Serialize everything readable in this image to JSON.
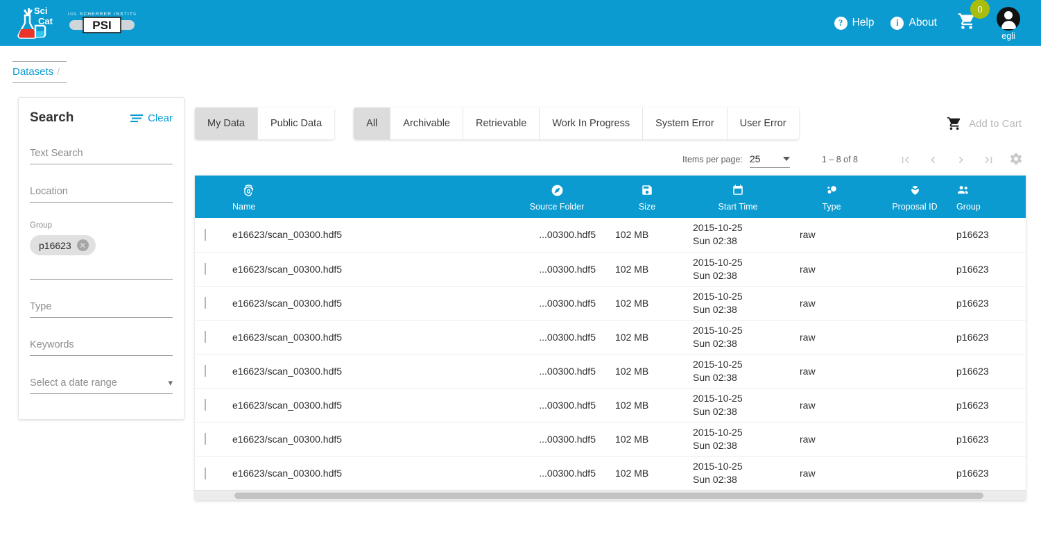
{
  "app": {
    "logo_primary": "scicat-logo",
    "logo_secondary": "psi-logo",
    "psi_tagline": "PAUL SCHERRER INSTITUT",
    "psi_name": "PSI",
    "scicat_name_top": "Sci",
    "scicat_name_bottom": "Cat",
    "brand_color": "#0b9bd0",
    "badge_color": "#a9bd0d"
  },
  "header": {
    "help_label": "Help",
    "help_glyph": "?",
    "about_label": "About",
    "about_glyph": "i",
    "cart_icon": "shopping-cart-icon",
    "cart_count": "0",
    "avatar_icon": "avatar-icon",
    "username": "egli"
  },
  "breadcrumb": {
    "items": [
      {
        "label": "Datasets"
      }
    ],
    "separator": "/"
  },
  "sidebar": {
    "title": "Search",
    "clear_label": "Clear",
    "clear_icon": "filter-icon",
    "text_search": {
      "label": "Text Search",
      "placeholder": "Text Search",
      "value": ""
    },
    "location": {
      "label": "Location",
      "placeholder": "Location",
      "value": ""
    },
    "group": {
      "label": "Group",
      "chips": [
        {
          "label": "p16623",
          "remove_icon": "close-icon"
        }
      ]
    },
    "type": {
      "label": "Type",
      "placeholder": "Type",
      "value": ""
    },
    "keywords": {
      "label": "Keywords",
      "placeholder": "Keywords",
      "value": ""
    },
    "date_range": {
      "label": "Select a date range",
      "value": "Select a date range",
      "chevron": "chevron-down-icon"
    }
  },
  "toolbar": {
    "ownership_tabs": [
      {
        "label": "My Data",
        "active": true
      },
      {
        "label": "Public Data",
        "active": false
      }
    ],
    "status_tabs": [
      {
        "label": "All",
        "active": true
      },
      {
        "label": "Archivable",
        "active": false
      },
      {
        "label": "Retrievable",
        "active": false
      },
      {
        "label": "Work In Progress",
        "active": false
      },
      {
        "label": "System Error",
        "active": false
      },
      {
        "label": "User Error",
        "active": false
      }
    ],
    "add_to_cart_label": "Add to Cart",
    "add_to_cart_icon": "shopping-cart-icon"
  },
  "pagination": {
    "items_per_page_label": "Items per page:",
    "items_per_page_value": "25",
    "range_label": "1 – 8 of 8",
    "first_page_icon": "first-page-icon",
    "prev_page_icon": "previous-page-icon",
    "next_page_icon": "next-page-icon",
    "last_page_icon": "last-page-icon",
    "settings_icon": "gear-icon"
  },
  "table": {
    "columns": [
      {
        "key": "name",
        "label": "Name",
        "icon": "fingerprint-icon"
      },
      {
        "key": "sourceFolder",
        "label": "Source Folder",
        "icon": "explore-compass-icon"
      },
      {
        "key": "size",
        "label": "Size",
        "icon": "save-floppy-icon"
      },
      {
        "key": "startTime",
        "label": "Start Time",
        "icon": "calendar-icon"
      },
      {
        "key": "type",
        "label": "Type",
        "icon": "bubble-chart-icon"
      },
      {
        "key": "proposalId",
        "label": "Proposal ID",
        "icon": "eco-leaf-icon"
      },
      {
        "key": "group",
        "label": "Group",
        "icon": "people-icon"
      }
    ],
    "rows": [
      {
        "name": "e16623/scan_00300.hdf5",
        "sourceFolder": "...00300.hdf5",
        "size": "102 MB",
        "date": "2015-10-25",
        "time": "Sun 02:38",
        "type": "raw",
        "proposalId": "",
        "group": "p16623"
      },
      {
        "name": "e16623/scan_00300.hdf5",
        "sourceFolder": "...00300.hdf5",
        "size": "102 MB",
        "date": "2015-10-25",
        "time": "Sun 02:38",
        "type": "raw",
        "proposalId": "",
        "group": "p16623"
      },
      {
        "name": "e16623/scan_00300.hdf5",
        "sourceFolder": "...00300.hdf5",
        "size": "102 MB",
        "date": "2015-10-25",
        "time": "Sun 02:38",
        "type": "raw",
        "proposalId": "",
        "group": "p16623"
      },
      {
        "name": "e16623/scan_00300.hdf5",
        "sourceFolder": "...00300.hdf5",
        "size": "102 MB",
        "date": "2015-10-25",
        "time": "Sun 02:38",
        "type": "raw",
        "proposalId": "",
        "group": "p16623"
      },
      {
        "name": "e16623/scan_00300.hdf5",
        "sourceFolder": "...00300.hdf5",
        "size": "102 MB",
        "date": "2015-10-25",
        "time": "Sun 02:38",
        "type": "raw",
        "proposalId": "",
        "group": "p16623"
      },
      {
        "name": "e16623/scan_00300.hdf5",
        "sourceFolder": "...00300.hdf5",
        "size": "102 MB",
        "date": "2015-10-25",
        "time": "Sun 02:38",
        "type": "raw",
        "proposalId": "",
        "group": "p16623"
      },
      {
        "name": "e16623/scan_00300.hdf5",
        "sourceFolder": "...00300.hdf5",
        "size": "102 MB",
        "date": "2015-10-25",
        "time": "Sun 02:38",
        "type": "raw",
        "proposalId": "",
        "group": "p16623"
      },
      {
        "name": "e16623/scan_00300.hdf5",
        "sourceFolder": "...00300.hdf5",
        "size": "102 MB",
        "date": "2015-10-25",
        "time": "Sun 02:38",
        "type": "raw",
        "proposalId": "",
        "group": "p16623"
      }
    ]
  }
}
